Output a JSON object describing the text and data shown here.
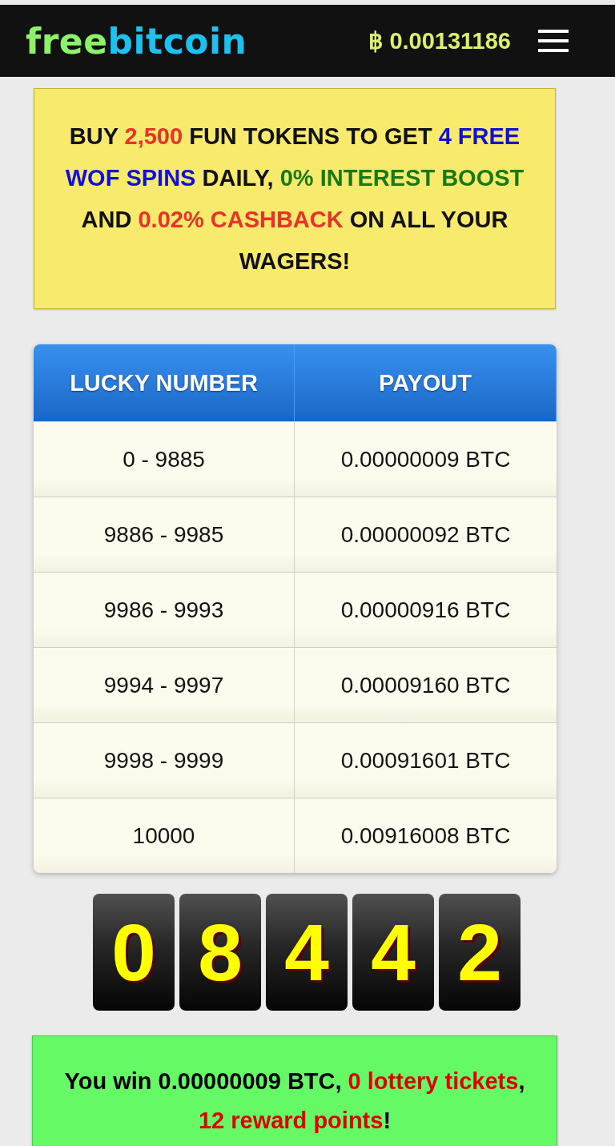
{
  "header": {
    "logo": [
      "free",
      "bitcoin"
    ],
    "balance": "฿ 0.00131186"
  },
  "promo": [
    {
      "text": "BUY ",
      "color": "#111111"
    },
    {
      "text": "2,500",
      "color": "#e8322a"
    },
    {
      "text": " FUN TOKENS TO GET ",
      "color": "#111111"
    },
    {
      "text": "4 FREE WOF SPINS",
      "color": "#1010d8"
    },
    {
      "text": " DAILY, ",
      "color": "#111111"
    },
    {
      "text": "0% INTEREST BOOST",
      "color": "#177a17"
    },
    {
      "text": " AND ",
      "color": "#111111"
    },
    {
      "text": "0.02% CASHBACK",
      "color": "#e8322a"
    },
    {
      "text": " ON ALL YOUR WAGERS!",
      "color": "#111111"
    }
  ],
  "table": {
    "columns": [
      "LUCKY NUMBER",
      "PAYOUT"
    ],
    "rows": [
      [
        "0 - 9885",
        "0.00000009 BTC"
      ],
      [
        "9886 - 9985",
        "0.00000092 BTC"
      ],
      [
        "9986 - 9993",
        "0.00000916 BTC"
      ],
      [
        "9994 - 9997",
        "0.00009160 BTC"
      ],
      [
        "9998 - 9999",
        "0.00091601 BTC"
      ],
      [
        "10000",
        "0.00916008 BTC"
      ]
    ]
  },
  "roll_digits": [
    "0",
    "8",
    "4",
    "4",
    "2"
  ],
  "result": [
    {
      "text": "You win 0.00000009 BTC, ",
      "color": "#000000"
    },
    {
      "text": "0 lottery tickets",
      "color": "#e00000"
    },
    {
      "text": ", ",
      "color": "#000000"
    },
    {
      "text": "12 reward points",
      "color": "#e00000"
    },
    {
      "text": "!",
      "color": "#000000"
    }
  ]
}
